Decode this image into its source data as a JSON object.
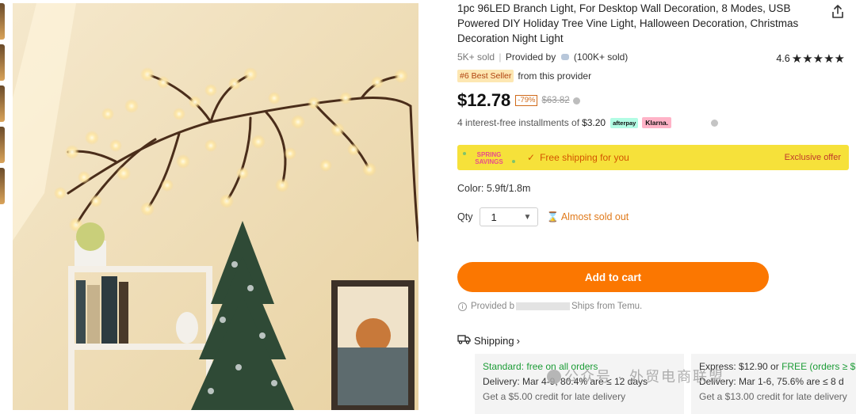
{
  "product": {
    "title": "1pc 96LED Branch Light, For Desktop Wall Decoration, 8 Modes, USB Powered DIY Holiday Tree Vine Light, Halloween Decoration, Christmas Decoration Night Light",
    "sold": "5K+ sold",
    "provided_by_label": "Provided by",
    "provider_sold": "(100K+ sold)",
    "rating": "4.6",
    "stars": "★★★★★",
    "bestseller_badge": "#6 Best Seller",
    "bestseller_text": "from this provider",
    "price": "$12.78",
    "discount": "-79%",
    "original_price": "$63.82",
    "installments_prefix": "4 interest-free installments of",
    "installment_amount": "$3.20",
    "afterpay_label": "afterpay",
    "klarna_label": "Klarna.",
    "promo": {
      "logo_line1": "SPRING",
      "logo_line2": "SAVINGS",
      "text": "Free shipping for you",
      "exclusive": "Exclusive offer"
    },
    "color": "Color: 5.9ft/1.8m",
    "qty_label": "Qty",
    "qty_value": "1",
    "almost_sold_out": "Almost sold out",
    "add_to_cart": "Add to cart",
    "provided_note_start": "Provided b",
    "provided_note_end": "Ships from Temu.",
    "shipping_label": "Shipping"
  },
  "shipping_options": {
    "standard": {
      "title_prefix": "Standard: ",
      "title": "free on all orders",
      "delivery": "Delivery: Mar 4-9, 80.4% are ≤ 12 days",
      "credit": "Get a $5.00 credit for late delivery"
    },
    "express": {
      "title_prefix": "Express: $12.90 or ",
      "title": "FREE (orders ≥ $",
      "delivery": "Delivery: Mar 1-6, 75.6% are ≤ 8 d",
      "credit": "Get a $13.00 credit for late delivery"
    }
  },
  "watermark": "公众号 · 外贸电商联盟",
  "colors": {
    "accent_orange": "#fb7701",
    "promo_yellow": "#f6e13a",
    "green": "#1c9c36"
  }
}
